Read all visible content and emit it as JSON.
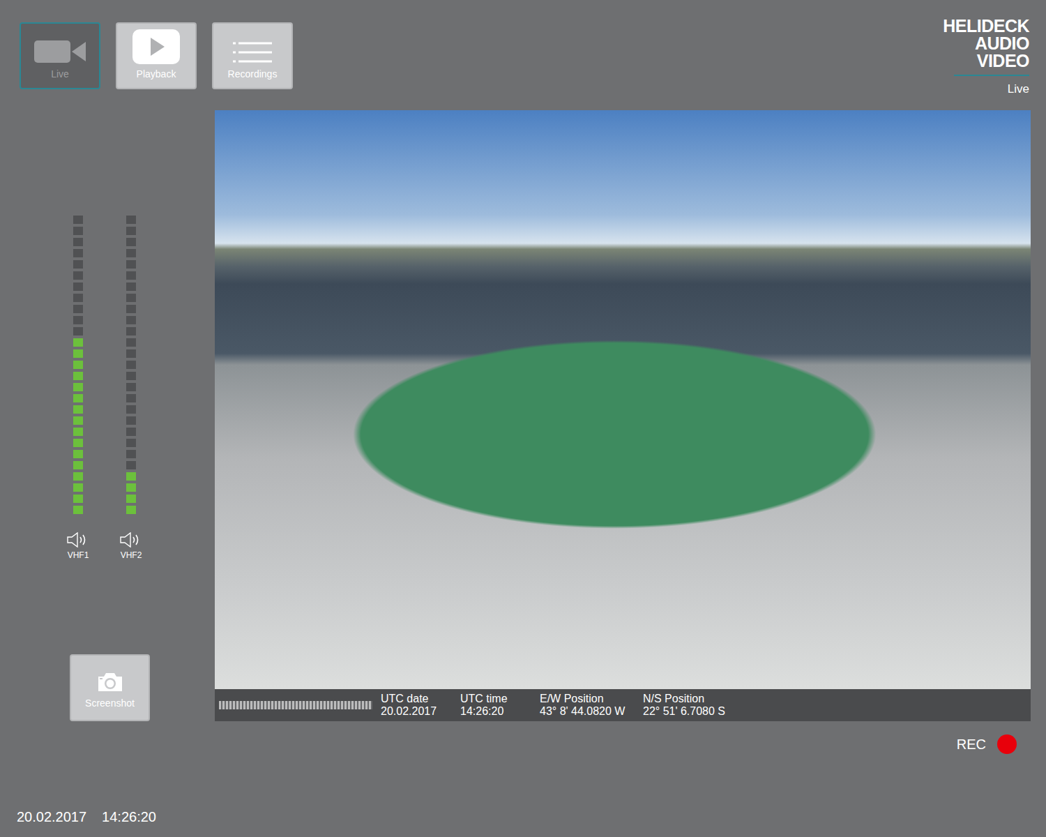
{
  "nav": [
    {
      "label": "Live",
      "selected": true
    },
    {
      "label": "Playback",
      "selected": false
    },
    {
      "label": "Recordings",
      "selected": false
    }
  ],
  "brand": {
    "lines": [
      "HELIDECK",
      "AUDIO",
      "VIDEO"
    ],
    "mode": "Live"
  },
  "meters": [
    {
      "name": "VHF1",
      "level": 0.59
    },
    {
      "name": "VHF2",
      "level": 0.15
    }
  ],
  "video": {
    "fields": [
      {
        "label": "UTC date",
        "value": "20.02.2017"
      },
      {
        "label": "UTC time",
        "value": "14:26:20"
      },
      {
        "label": "E/W Position",
        "value": "43° 8' 44.0820 W"
      },
      {
        "label": "N/S Position",
        "value": "22° 51' 6.7080 S"
      }
    ]
  },
  "screenshot_button": {
    "label": "Screenshot"
  },
  "recording": {
    "label": "REC",
    "on": true
  },
  "status_bar": {
    "date": "20.02.2017",
    "time": "14:26:20"
  }
}
